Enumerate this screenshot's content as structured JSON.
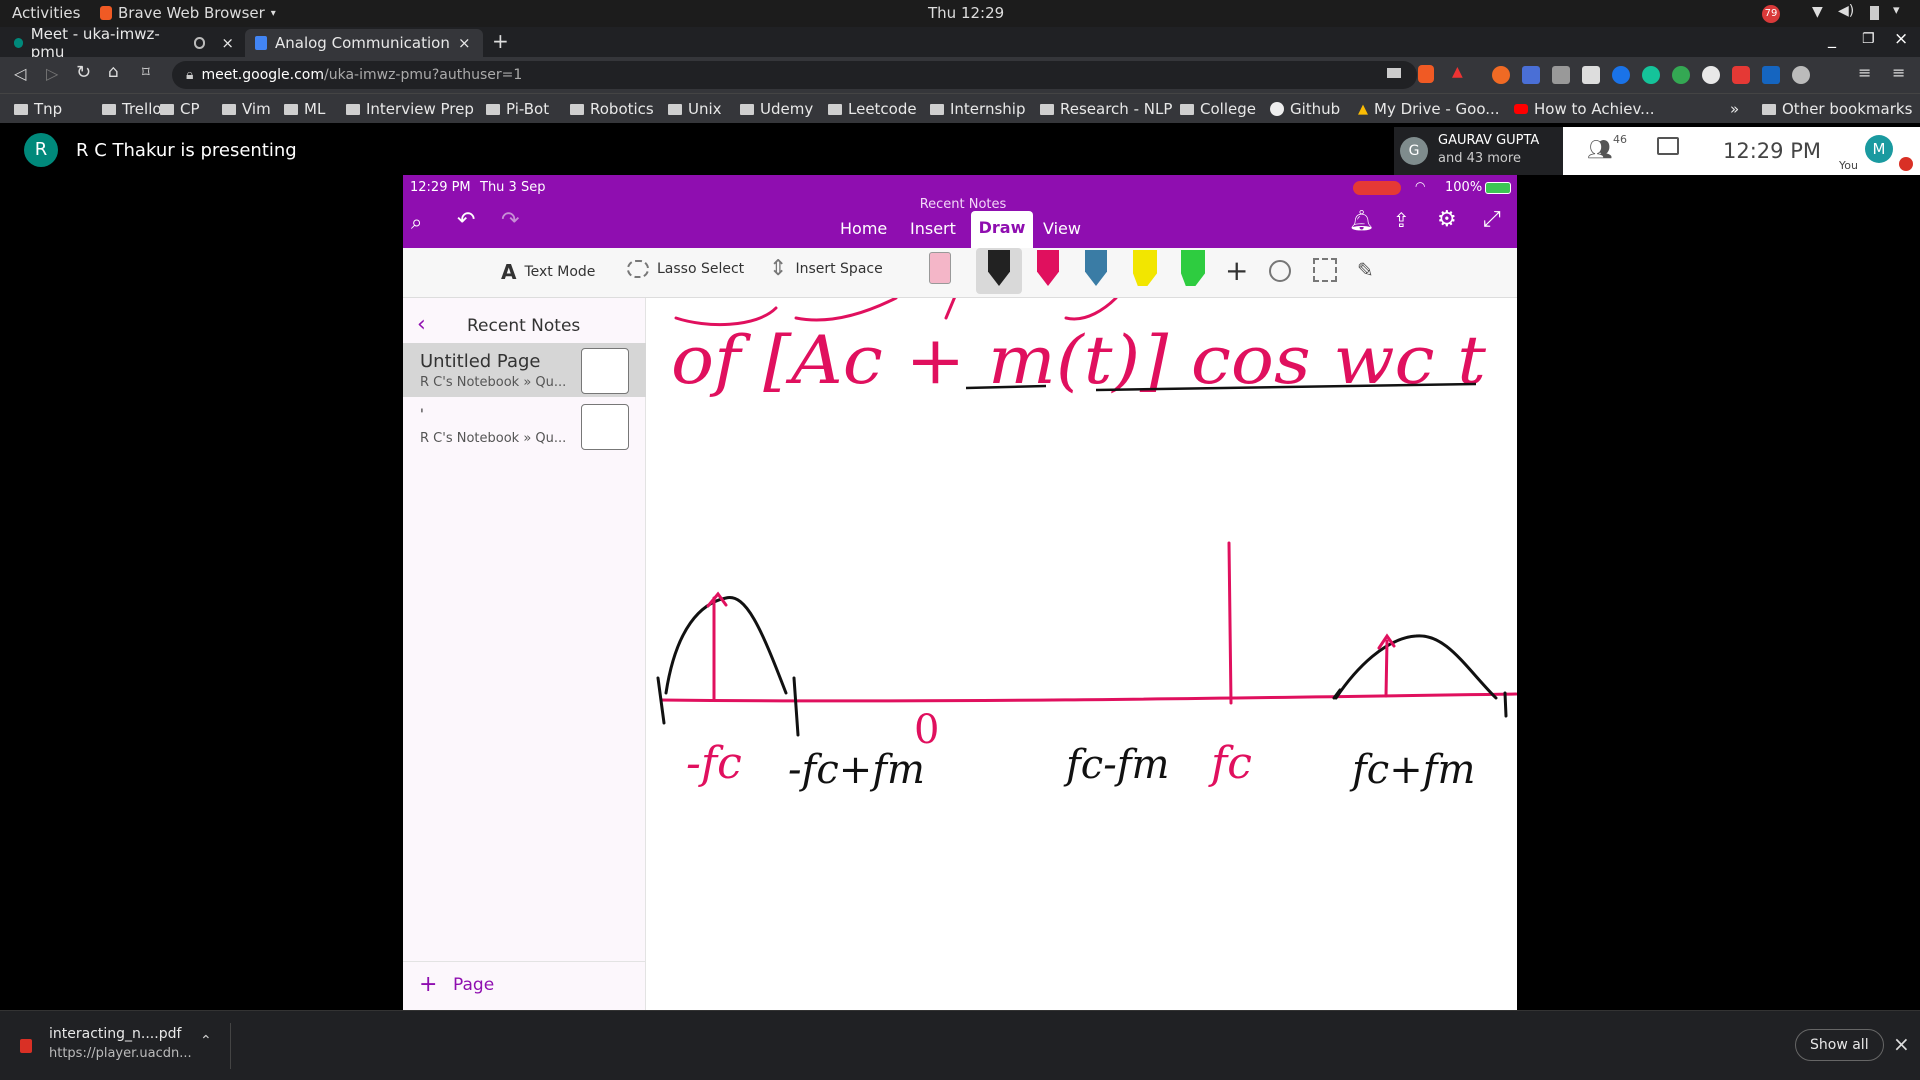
{
  "os": {
    "activities": "Activities",
    "browser_menu": "Brave Web Browser",
    "clock": "Thu 12:29",
    "badge": "79"
  },
  "tabs": [
    {
      "label": "Meet - uka-imwz-pmu"
    },
    {
      "label": "Analog Communication Sy"
    }
  ],
  "address": {
    "host": "meet.google.com",
    "path": "/uka-imwz-pmu?authuser=1"
  },
  "bookmarks": [
    "Tnp",
    "Trello",
    "CP",
    "Vim",
    "ML",
    "Interview Prep",
    "Pi-Bot",
    "Robotics",
    "Unix",
    "Udemy",
    "Leetcode",
    "Internship",
    "Research - NLP",
    "College",
    "Github",
    "My Drive - Goo...",
    "How to Achiev...",
    "»",
    "Other bookmarks"
  ],
  "meet": {
    "presenter_initial": "R",
    "presenting": "R C Thakur is presenting",
    "participant_initial": "G",
    "participant_name": "GAURAV GUPTA",
    "participant_more": "and 43 more",
    "people_count": "46",
    "time": "12:29  PM",
    "self_initial": "M",
    "self_label": "You"
  },
  "tablet": {
    "time": "12:29 PM",
    "date": "Thu 3 Sep",
    "notebook_title": "Recent Notes",
    "battery": "100%",
    "tabs": [
      "Home",
      "Insert",
      "Draw",
      "View"
    ],
    "active_tab": "Draw",
    "tools": {
      "text_mode": "Text Mode",
      "lasso": "Lasso Select",
      "insert_space": "Insert Space"
    },
    "sidebar_title": "Recent Notes",
    "pages": [
      {
        "title": "Untitled Page",
        "sub": "R C's Notebook » Qu..."
      },
      {
        "title": "'",
        "sub": "R C's Notebook » Qu..."
      }
    ],
    "add_page": "Page"
  },
  "handwriting": {
    "line1": "of [Ac + m(t)] cos wc t",
    "labels": [
      "-fc",
      "-fc+fm",
      "0",
      "fc-fm",
      "fc",
      "fc+fm"
    ]
  },
  "colors": {
    "onenote_purple": "#8f0eb0",
    "ink_pink": "#e0105e",
    "ink_black": "#111111"
  },
  "download": {
    "file": "interacting_n....pdf",
    "url": "https://player.uacdn...",
    "show_all": "Show all"
  }
}
